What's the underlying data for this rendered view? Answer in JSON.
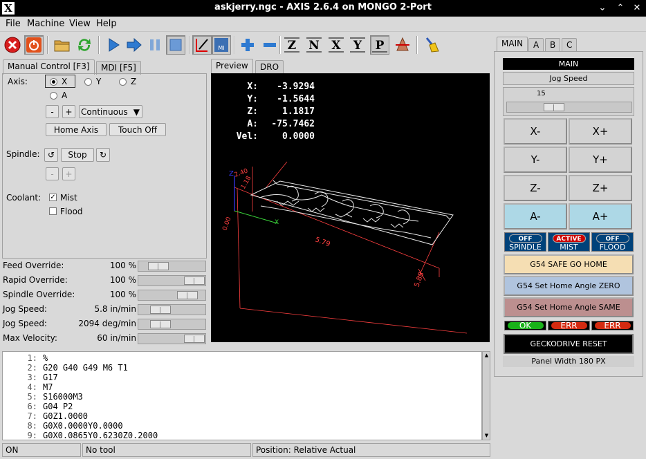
{
  "window": {
    "title": "askjerry.ngc - AXIS 2.6.4 on MONGO 2-Port",
    "logo": "X"
  },
  "menu": [
    "File",
    "Machine",
    "View",
    "Help"
  ],
  "toolbar": {
    "icons": [
      "estop-icon",
      "machine-power-icon",
      "open-file-icon",
      "reload-icon",
      "run-icon",
      "step-icon",
      "pause-icon",
      "stop-icon",
      "touch-off-icon",
      "mdi-icon",
      "zoom-in-icon",
      "zoom-out-icon",
      "view-z-icon",
      "view-z2-icon",
      "view-x-icon",
      "view-y-icon",
      "view-p-icon",
      "rotate-icon",
      "clear-icon"
    ],
    "mdi_label": "MI",
    "view_z": "Z",
    "view_z2": "N",
    "view_x": "X",
    "view_y": "Y",
    "view_p": "P"
  },
  "left_tabs": [
    "Manual Control [F3]",
    "MDI [F5]"
  ],
  "manual": {
    "axis_label": "Axis:",
    "axes": [
      "X",
      "Y",
      "Z",
      "A"
    ],
    "selected_axis": "X",
    "minus": "-",
    "plus": "+",
    "jog_mode": "Continuous",
    "home_axis": "Home Axis",
    "touch_off": "Touch Off",
    "spindle_label": "Spindle:",
    "spindle_stop": "Stop",
    "coolant_label": "Coolant:",
    "mist": "Mist",
    "mist_checked": true,
    "flood": "Flood",
    "flood_checked": false
  },
  "overrides": [
    {
      "label": "Feed Override:",
      "value": "100 %",
      "level": 0.2
    },
    {
      "label": "Rapid Override:",
      "value": "100 %",
      "level": 1.0
    },
    {
      "label": "Spindle Override:",
      "value": "100 %",
      "level": 0.85
    },
    {
      "label": "Jog Speed:",
      "value": "5.8 in/min",
      "level": 0.25
    },
    {
      "label": "Jog Speed:",
      "value": "2094 deg/min",
      "level": 0.25
    },
    {
      "label": "Max Velocity:",
      "value": "60 in/min",
      "level": 1.0
    }
  ],
  "preview_tabs": [
    "Preview",
    "DRO"
  ],
  "dro": [
    {
      "axis": "X:",
      "value": "-3.9294"
    },
    {
      "axis": "Y:",
      "value": "-1.5644"
    },
    {
      "axis": "Z:",
      "value": "1.1817"
    },
    {
      "axis": "A:",
      "value": "-75.7462"
    },
    {
      "axis": "Vel:",
      "value": "0.0000"
    }
  ],
  "preview_labels": {
    "dim_x": "5.79",
    "dim_y": "5.88",
    "dim_z1": "2.40",
    "dim_z2": "1.18",
    "dim_0": "0.00",
    "axis_z": "Z",
    "axis_x": "X"
  },
  "gcode": [
    {
      "n": "1:",
      "t": "%"
    },
    {
      "n": "2:",
      "t": "G20 G40 G49 M6 T1"
    },
    {
      "n": "3:",
      "t": "G17"
    },
    {
      "n": "4:",
      "t": "M7"
    },
    {
      "n": "5:",
      "t": "S16000M3"
    },
    {
      "n": "6:",
      "t": "G04 P2"
    },
    {
      "n": "7:",
      "t": "G0Z1.0000"
    },
    {
      "n": "8:",
      "t": "G0X0.0000Y0.0000"
    },
    {
      "n": "9:",
      "t": "G0X0.0865Y0.6230Z0.2000"
    }
  ],
  "status": {
    "state": "ON",
    "tool": "No tool",
    "position": "Position: Relative Actual"
  },
  "panel": {
    "tabs": [
      "MAIN",
      "A",
      "B",
      "C"
    ],
    "header": "MAIN",
    "jog_speed_label": "Jog Speed",
    "jog_speed_value": "15",
    "jog_level": 0.35,
    "jog_buttons": [
      [
        "X-",
        "X+"
      ],
      [
        "Y-",
        "Y+"
      ],
      [
        "Z-",
        "Z+"
      ],
      [
        "A-",
        "A+"
      ]
    ],
    "indicators": [
      {
        "state": "OFF",
        "label": "SPINDLE",
        "color": "#00427a"
      },
      {
        "state": "ACTIVE",
        "label": "MIST",
        "color": "#cc0000"
      },
      {
        "state": "OFF",
        "label": "FLOOD",
        "color": "#00427a"
      }
    ],
    "g54_home": "G54 SAFE GO HOME",
    "g54_zero": "G54 Set Home Angle ZERO",
    "g54_same": "G54 Set Home Angle SAME",
    "leds": [
      {
        "text": "OK",
        "color": "#19b219"
      },
      {
        "text": "ERR",
        "color": "#d42a10"
      },
      {
        "text": "ERR",
        "color": "#d42a10"
      }
    ],
    "gecko_reset": "GECKODRIVE RESET",
    "panel_width": "Panel Width 180 PX"
  },
  "colors": {
    "home_button": "#f5deb3",
    "zero_button": "#b0c4de",
    "same_button": "#bc8f8f",
    "a_buttons": "#add8e6"
  }
}
